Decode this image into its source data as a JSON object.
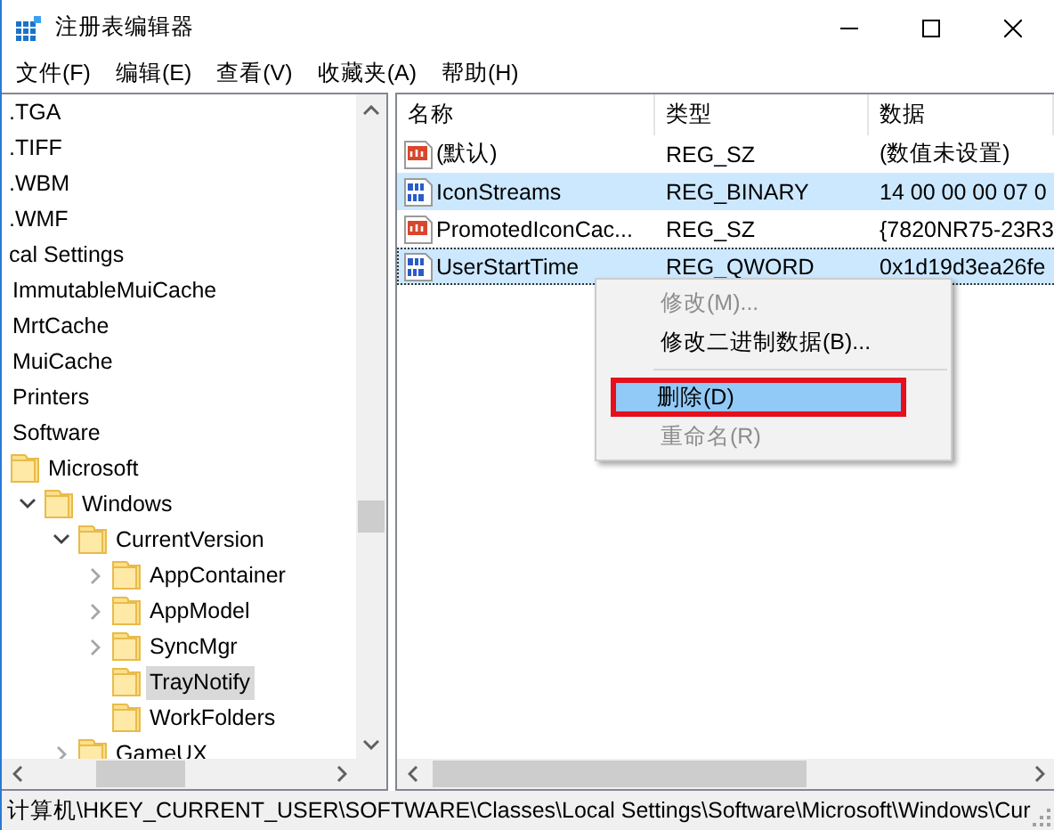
{
  "window": {
    "title": "注册表编辑器"
  },
  "menu": [
    "文件(F)",
    "编辑(E)",
    "查看(V)",
    "收藏夹(A)",
    "帮助(H)"
  ],
  "tree": [
    {
      "label": ".TGA",
      "selected": false
    },
    {
      "label": ".TIFF",
      "selected": false
    },
    {
      "label": ".WBM",
      "selected": false
    },
    {
      "label": ".WMF",
      "selected": false
    },
    {
      "label": "cal Settings",
      "selected": false,
      "children": [
        {
          "label": "ImmutableMuiCache",
          "selected": false
        },
        {
          "label": "MrtCache",
          "selected": false
        },
        {
          "label": "MuiCache",
          "selected": false
        },
        {
          "label": "Printers",
          "selected": false
        },
        {
          "label": "Software",
          "selected": false,
          "children": [
            {
              "label": "Microsoft",
              "selected": false,
              "children": [
                {
                  "label": "Windows",
                  "selected": false,
                  "expanded": true,
                  "children": [
                    {
                      "label": "CurrentVersion",
                      "selected": false,
                      "expanded": true,
                      "children": [
                        {
                          "label": "AppContainer",
                          "selected": false,
                          "expanded": false
                        },
                        {
                          "label": "AppModel",
                          "selected": false,
                          "expanded": false
                        },
                        {
                          "label": "SyncMgr",
                          "selected": false,
                          "expanded": false
                        },
                        {
                          "label": "TrayNotify",
                          "selected": true
                        },
                        {
                          "label": "WorkFolders",
                          "selected": false
                        }
                      ]
                    },
                    {
                      "label": "GameUX",
                      "selected": false,
                      "expanded": false
                    }
                  ]
                }
              ]
            }
          ]
        }
      ]
    }
  ],
  "table": {
    "columns": [
      "名称",
      "类型",
      "数据"
    ],
    "rows": [
      {
        "kind": "string",
        "name": "(默认)",
        "type": "REG_SZ",
        "data": "(数值未设置)",
        "selected": false,
        "focused": false
      },
      {
        "kind": "binary",
        "name": "IconStreams",
        "type": "REG_BINARY",
        "data": "14 00 00 00 07 0",
        "selected": true,
        "focused": false
      },
      {
        "kind": "string",
        "name": "PromotedIconCac...",
        "type": "REG_SZ",
        "data": "{7820NR75-23R3",
        "selected": false,
        "focused": false
      },
      {
        "kind": "binary",
        "name": "UserStartTime",
        "type": "REG_QWORD",
        "data": "0x1d19d3ea26fe",
        "selected": true,
        "focused": true
      }
    ]
  },
  "context_menu": [
    {
      "kind": "item",
      "label": "修改(M)...",
      "disabled": true,
      "selected": false,
      "outlined": false
    },
    {
      "kind": "item",
      "label": "修改二进制数据(B)...",
      "disabled": false,
      "selected": false,
      "outlined": false
    },
    {
      "kind": "separator"
    },
    {
      "kind": "item",
      "label": "删除(D)",
      "disabled": false,
      "selected": true,
      "outlined": true
    },
    {
      "kind": "item",
      "label": "重命名(R)",
      "disabled": true,
      "selected": false,
      "outlined": false
    }
  ],
  "status_bar": "计算机\\HKEY_CURRENT_USER\\SOFTWARE\\Classes\\Local Settings\\Software\\Microsoft\\Windows\\Cur"
}
